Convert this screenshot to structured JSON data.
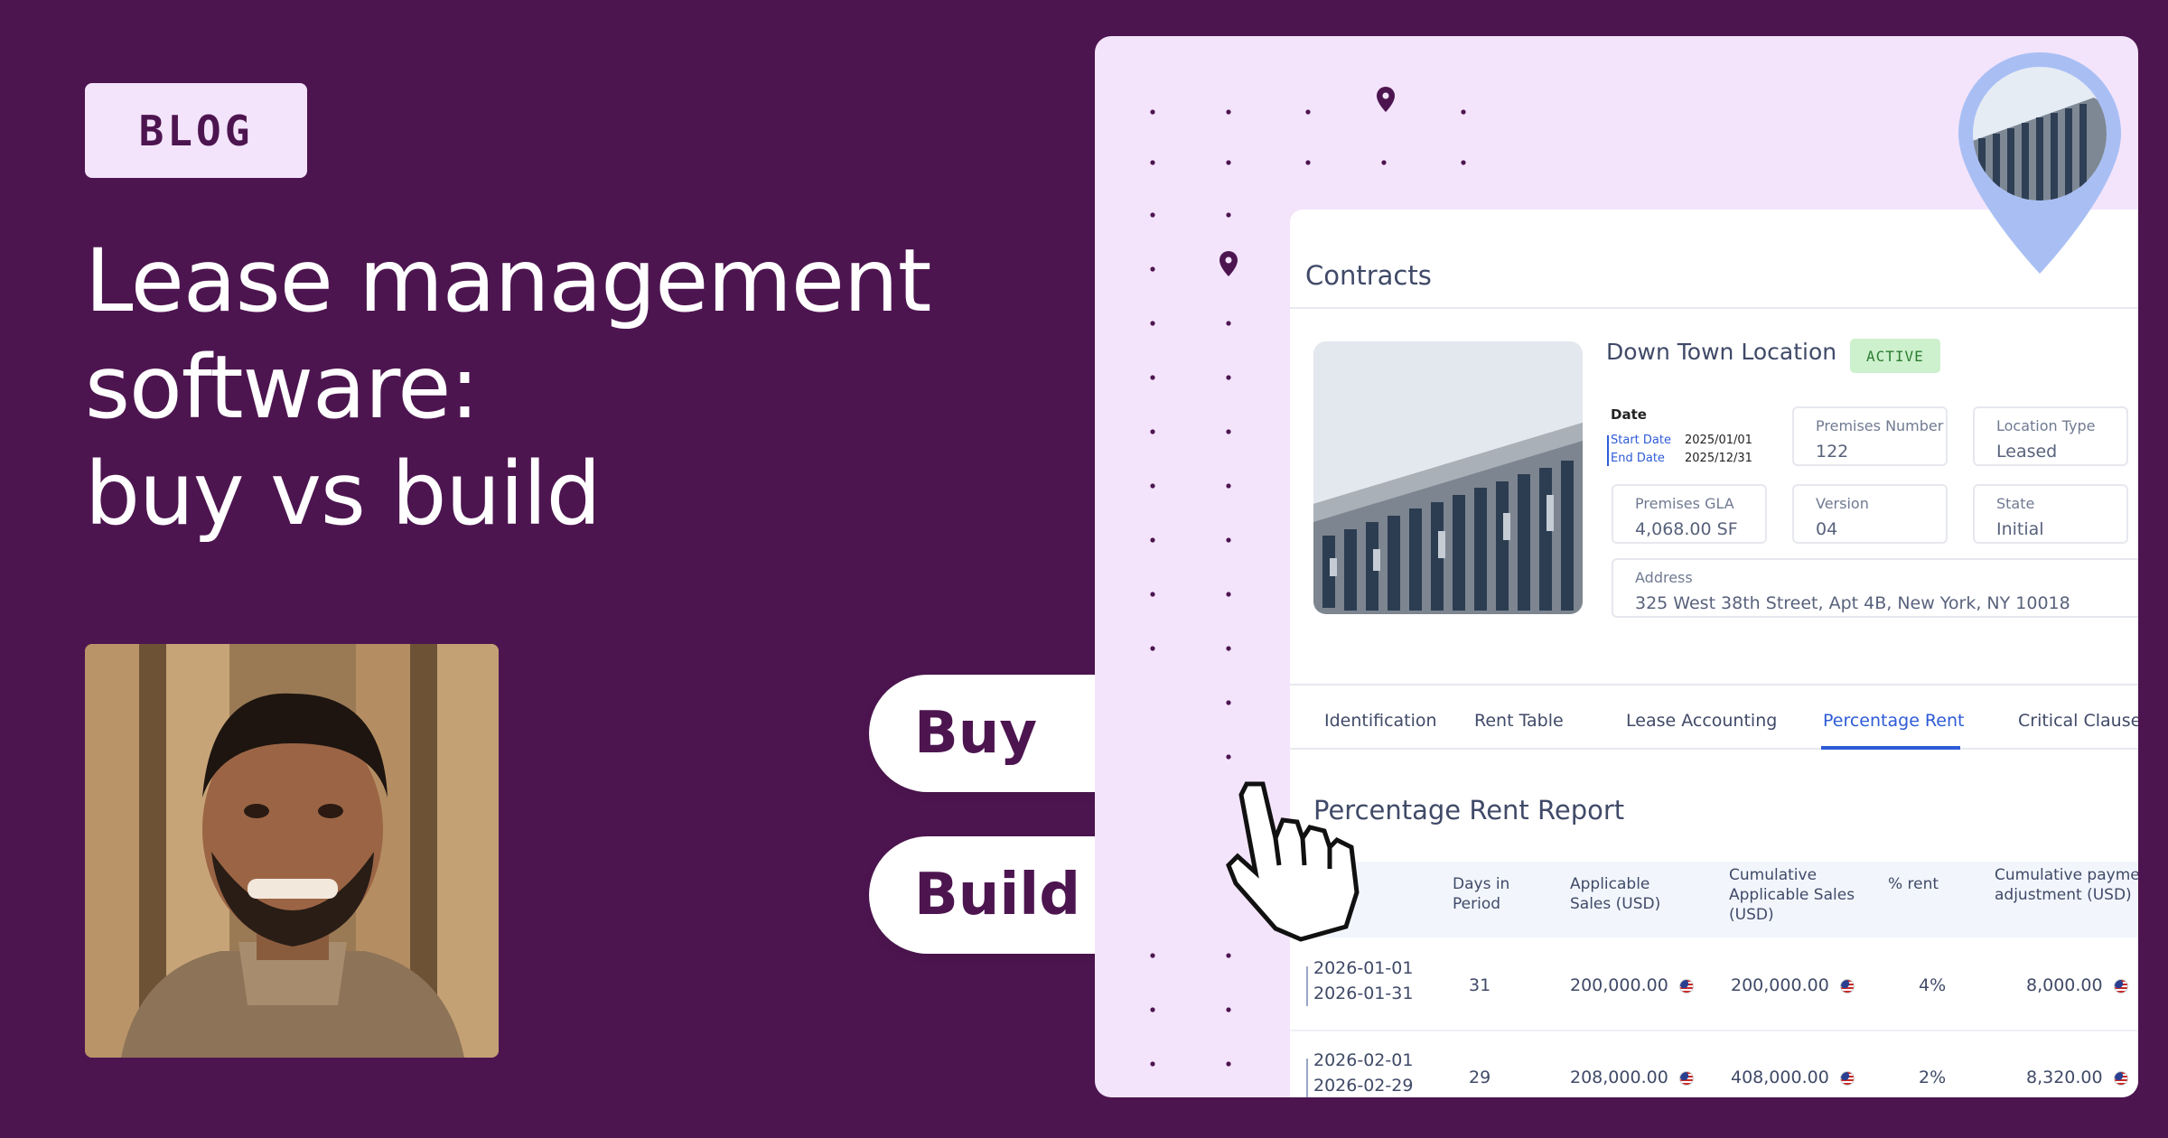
{
  "left": {
    "badge": "BLOG",
    "headline": {
      "line1": "Lease management",
      "line2": "software:",
      "line3": "buy vs build"
    }
  },
  "options": {
    "buy_label": "Buy",
    "build_label": "Build"
  },
  "contract": {
    "section_title": "Contracts",
    "location_name": "Down Town Location",
    "status": "ACTIVE",
    "date": {
      "label": "Date",
      "start_label": "Start Date",
      "start_value": "2025/01/01",
      "end_label": "End Date",
      "end_value": "2025/12/31"
    },
    "fields": {
      "premises_number": {
        "label": "Premises Number",
        "value": "122"
      },
      "location_type": {
        "label": "Location Type",
        "value": "Leased"
      },
      "premises_gla": {
        "label": "Premises GLA",
        "value": "4,068.00 SF"
      },
      "version": {
        "label": "Version",
        "value": "04"
      },
      "state": {
        "label": "State",
        "value": "Initial"
      },
      "address": {
        "label": "Address",
        "value": "325 West 38th Street, Apt 4B, New York, NY 10018"
      }
    },
    "tabs": [
      {
        "label": "Identification"
      },
      {
        "label": "Rent Table"
      },
      {
        "label": "Lease Accounting"
      },
      {
        "label": "Percentage Rent"
      },
      {
        "label": "Critical Clauses"
      }
    ],
    "report": {
      "title": "Percentage Rent Report",
      "columns": {
        "days": "Days in Period",
        "sales": "Applicable Sales (USD)",
        "cumulative": "Cumulative Applicable Sales (USD)",
        "rent_pct": "% rent",
        "payment": "Cumulative payment adjustment (USD)"
      },
      "rows": [
        {
          "start": "2026-01-01",
          "end": "2026-01-31",
          "days": "31",
          "sales": "200,000.00",
          "cumulative": "200,000.00",
          "rent_pct": "4%",
          "payment": "8,000.00"
        },
        {
          "start": "2026-02-01",
          "end": "2026-02-29",
          "days": "29",
          "sales": "208,000.00",
          "cumulative": "408,000.00",
          "rent_pct": "2%",
          "payment": "8,320.00"
        }
      ]
    }
  },
  "colors": {
    "background": "#4d1550",
    "card": "#f3e4fb",
    "accent_blue": "#2e5bd6",
    "arrow_circle": "#c8d8fa",
    "active_badge": "#cdf0cd"
  },
  "icons": [
    "arrow-right-icon",
    "map-pin-icon",
    "pointer-hand-icon",
    "us-flag-icon"
  ]
}
